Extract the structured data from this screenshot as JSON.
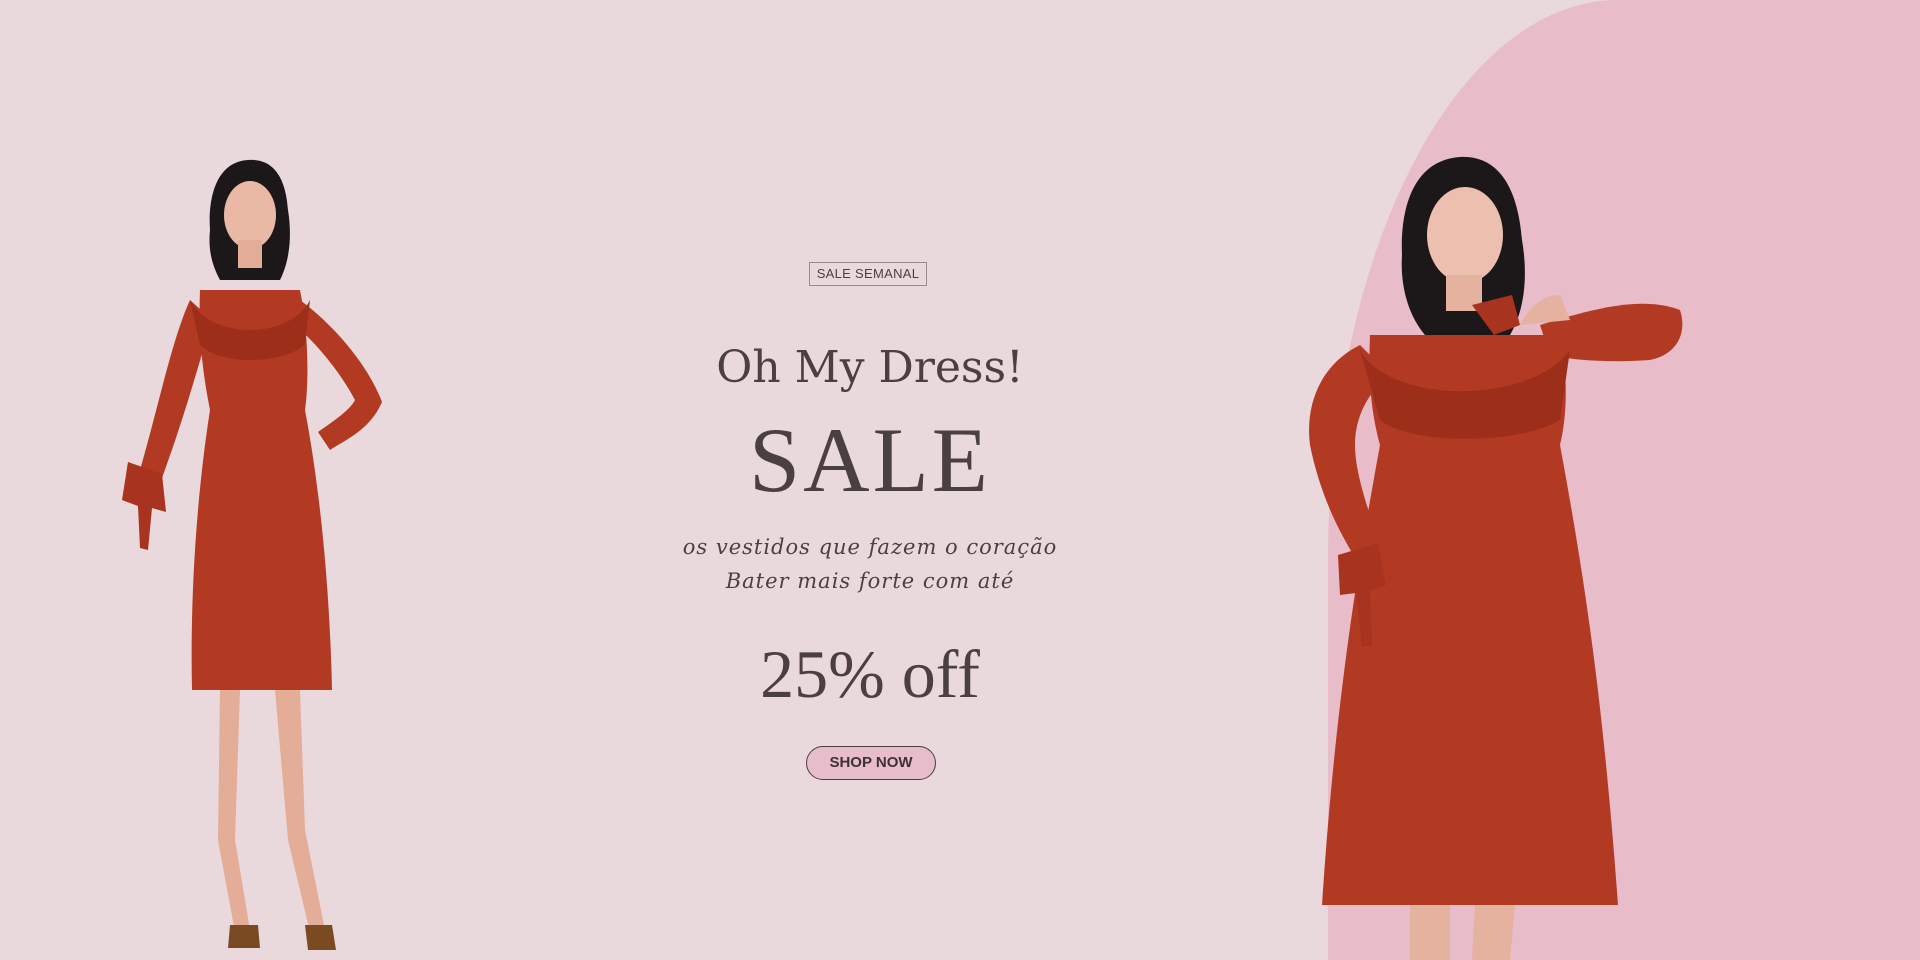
{
  "banner": {
    "tag": "SALE SEMANAL",
    "headline": "Oh My Dress!",
    "sale": "SALE",
    "subline_1": "os vestidos que fazem o coração",
    "subline_2": "Bater mais forte com até",
    "offer": "25% off",
    "cta_label": "SHOP NOW"
  },
  "colors": {
    "background": "#e9d8dc",
    "arc": "#e8bcc9",
    "text": "#4a3f41",
    "dress": "#b33a22",
    "button_fill": "#e7bccb"
  },
  "icons": {
    "left_model": "model-red-dress-photo",
    "right_model": "model-red-dress-photo"
  }
}
